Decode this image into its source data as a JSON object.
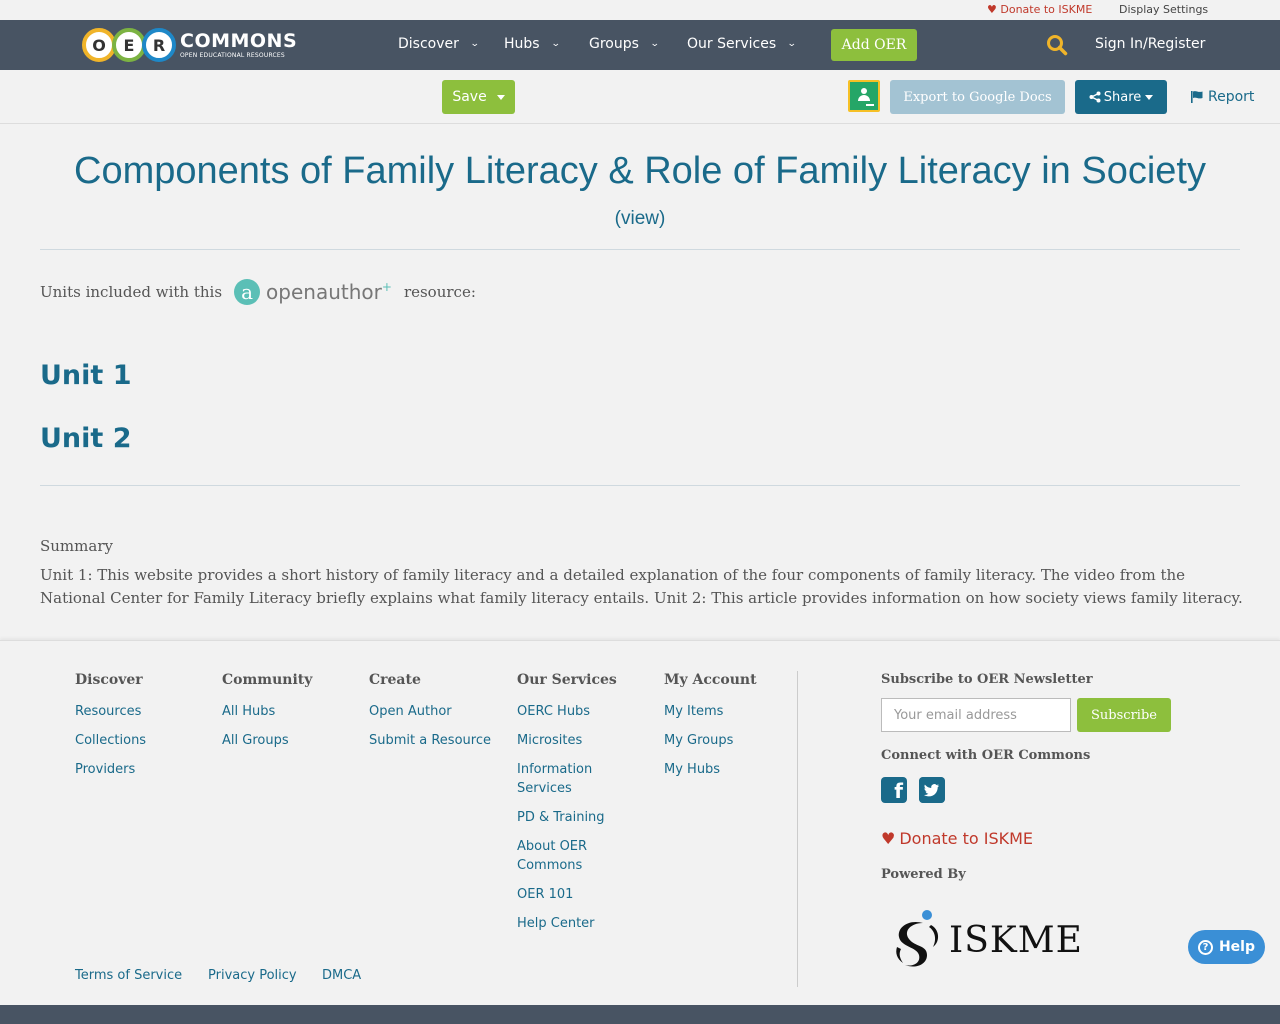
{
  "utility": {
    "donate": "Donate to ISKME",
    "display_settings": "Display Settings"
  },
  "nav": {
    "logo_letters": [
      "O",
      "E",
      "R"
    ],
    "logo_title": "COMMONS",
    "logo_subtitle": "OPEN EDUCATIONAL RESOURCES",
    "items": [
      {
        "label": "Discover"
      },
      {
        "label": "Hubs"
      },
      {
        "label": "Groups"
      },
      {
        "label": "Our Services"
      }
    ],
    "add_oer": "Add OER",
    "signin": "Sign In/Register"
  },
  "toolbar": {
    "save": "Save",
    "export": "Export to Google Docs",
    "share": "Share",
    "report": "Report"
  },
  "resource": {
    "title": "Components of Family Literacy & Role of Family Literacy in Society",
    "view_link": "(view)",
    "units_intro_before": "Units included with this",
    "units_intro_after": "resource:",
    "openauthor_brand": "openauthor",
    "units": [
      "Unit 1",
      "Unit 2"
    ],
    "summary_label": "Summary",
    "summary_text": "Unit 1: This website provides a short history of family literacy and a detailed explanation of the four components of family literacy. The video from the National Center for Family Literacy briefly explains what family literacy entails. Unit 2: This article provides information on how society views family literacy."
  },
  "footer": {
    "columns": [
      {
        "heading": "Discover",
        "links": [
          "Resources",
          "Collections",
          "Providers"
        ]
      },
      {
        "heading": "Community",
        "links": [
          "All Hubs",
          "All Groups"
        ]
      },
      {
        "heading": "Create",
        "links": [
          "Open Author",
          "Submit a Resource"
        ]
      },
      {
        "heading": "Our Services",
        "links": [
          "OERC Hubs",
          "Microsites",
          "Information Services",
          "PD & Training",
          "About OER Commons",
          "OER 101",
          "Help Center"
        ]
      },
      {
        "heading": "My Account",
        "links": [
          "My Items",
          "My Groups",
          "My Hubs"
        ]
      }
    ],
    "newsletter_title": "Subscribe to OER Newsletter",
    "email_placeholder": "Your email address",
    "subscribe": "Subscribe",
    "connect_title": "Connect with OER Commons",
    "donate": "Donate to ISKME",
    "powered_by": "Powered By",
    "iskme": "ISKME",
    "help": "Help",
    "legal": [
      "Terms of Service",
      "Privacy Policy",
      "DMCA"
    ]
  },
  "colors": {
    "nav_bg": "#485463",
    "primary": "#1a6a8a",
    "green": "#8dbf3d",
    "donate_red": "#c0392b"
  }
}
